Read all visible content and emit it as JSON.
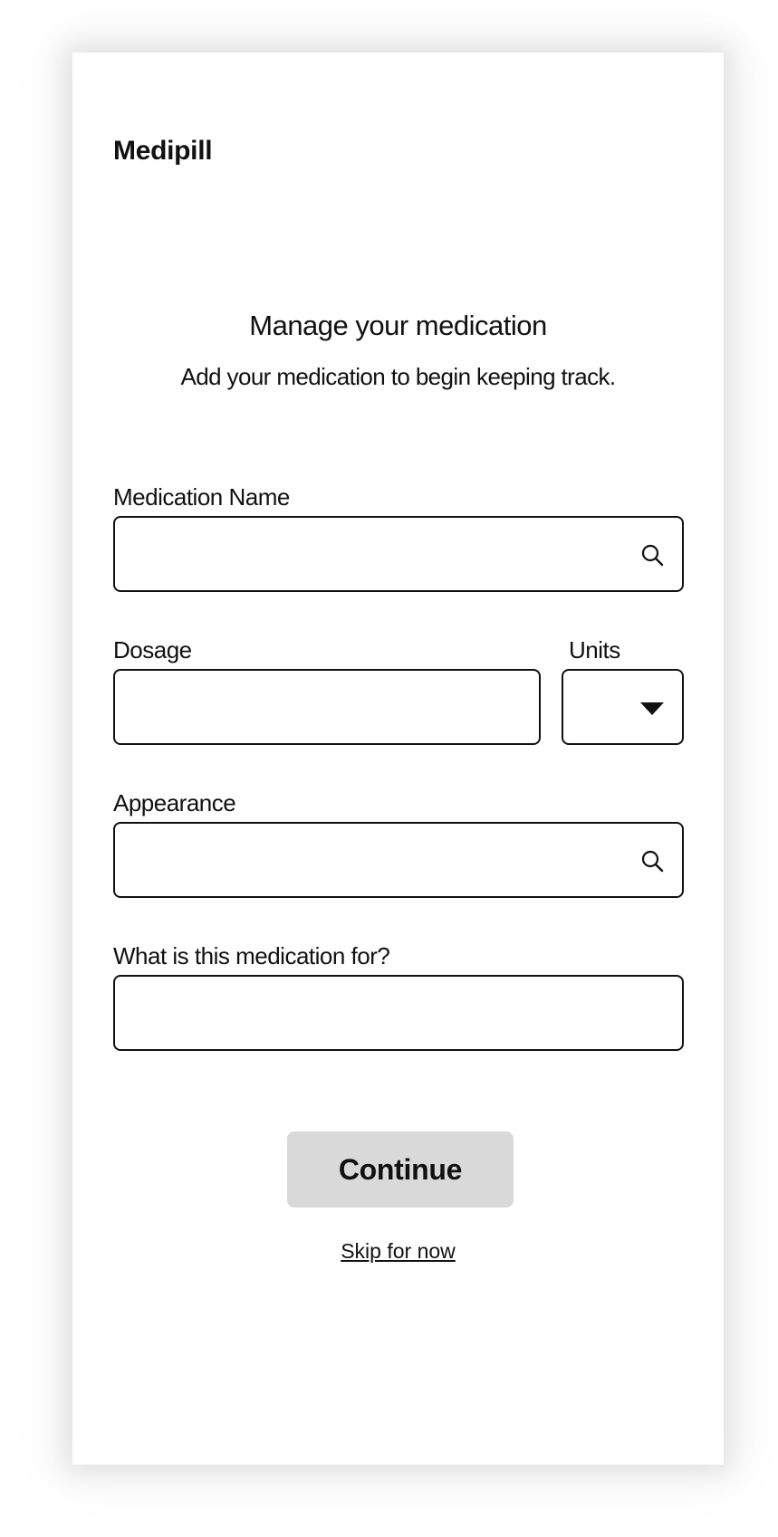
{
  "app": {
    "brand": "Medipill"
  },
  "header": {
    "title": "Manage your medication",
    "subtitle": "Add your medication to begin keeping track."
  },
  "form": {
    "medication_name": {
      "label": "Medication Name",
      "value": "",
      "icon": "search-icon"
    },
    "dosage": {
      "label": "Dosage",
      "value": ""
    },
    "units": {
      "label": "Units",
      "selected": "",
      "icon": "caret-down-icon"
    },
    "appearance": {
      "label": "Appearance",
      "value": "",
      "icon": "search-icon"
    },
    "purpose": {
      "label": "What is this medication for?",
      "value": ""
    }
  },
  "actions": {
    "continue_label": "Continue",
    "skip_label": "Skip for now"
  },
  "colors": {
    "button_bg": "#d9d9d9",
    "border": "#111111",
    "text": "#111111"
  }
}
